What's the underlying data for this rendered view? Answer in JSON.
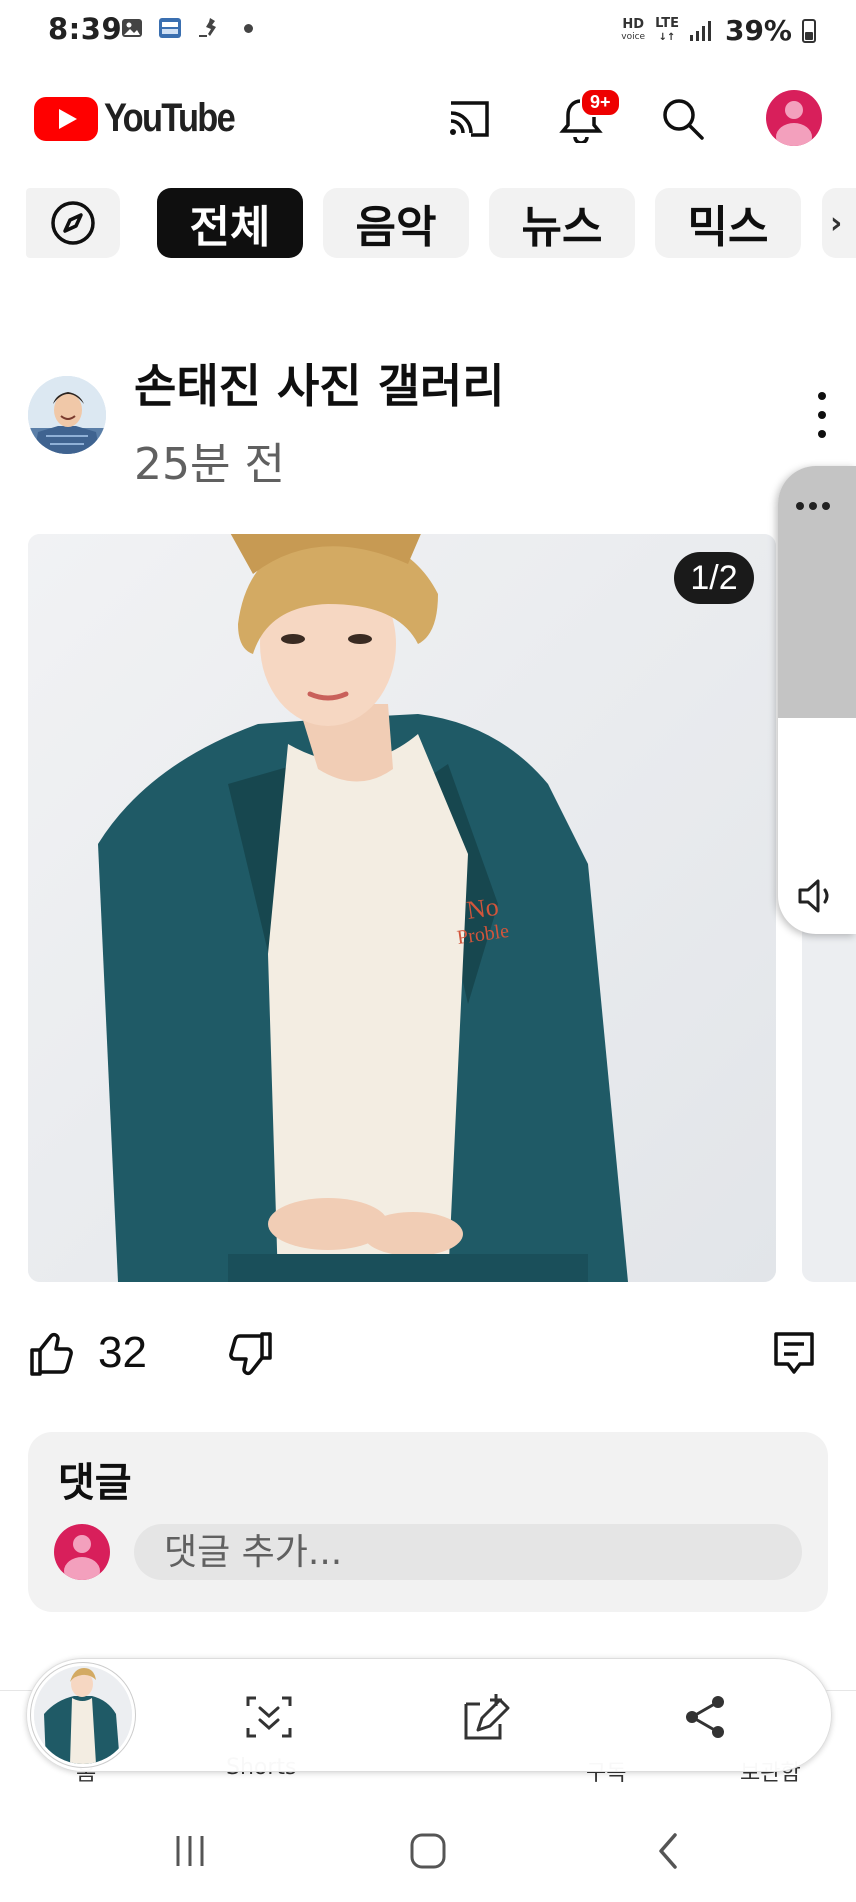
{
  "status_bar": {
    "time": "8:39",
    "hd": "HD",
    "hd_sub": "voice",
    "network": "LTE",
    "battery": "39%"
  },
  "header": {
    "logo_text": "YouTube",
    "notification_badge": "9+",
    "brand_color": "#ff0000"
  },
  "chips": {
    "explore_icon": "compass-icon",
    "items": [
      "전체",
      "음악",
      "뉴스",
      "믹스"
    ]
  },
  "post": {
    "channel_name": "손태진 사진 갤러리",
    "time": "25분 전",
    "image_counter": "1/2",
    "likes": "32"
  },
  "comments": {
    "title": "댓글",
    "placeholder": "댓글 추가..."
  },
  "bottom_nav": {
    "labels": [
      "홈",
      "Shorts",
      "구독",
      "보관함"
    ]
  },
  "colors": {
    "accent_red": "#ff0000",
    "avatar_pink": "#d81f5b",
    "jacket_teal": "#1f5a66"
  }
}
